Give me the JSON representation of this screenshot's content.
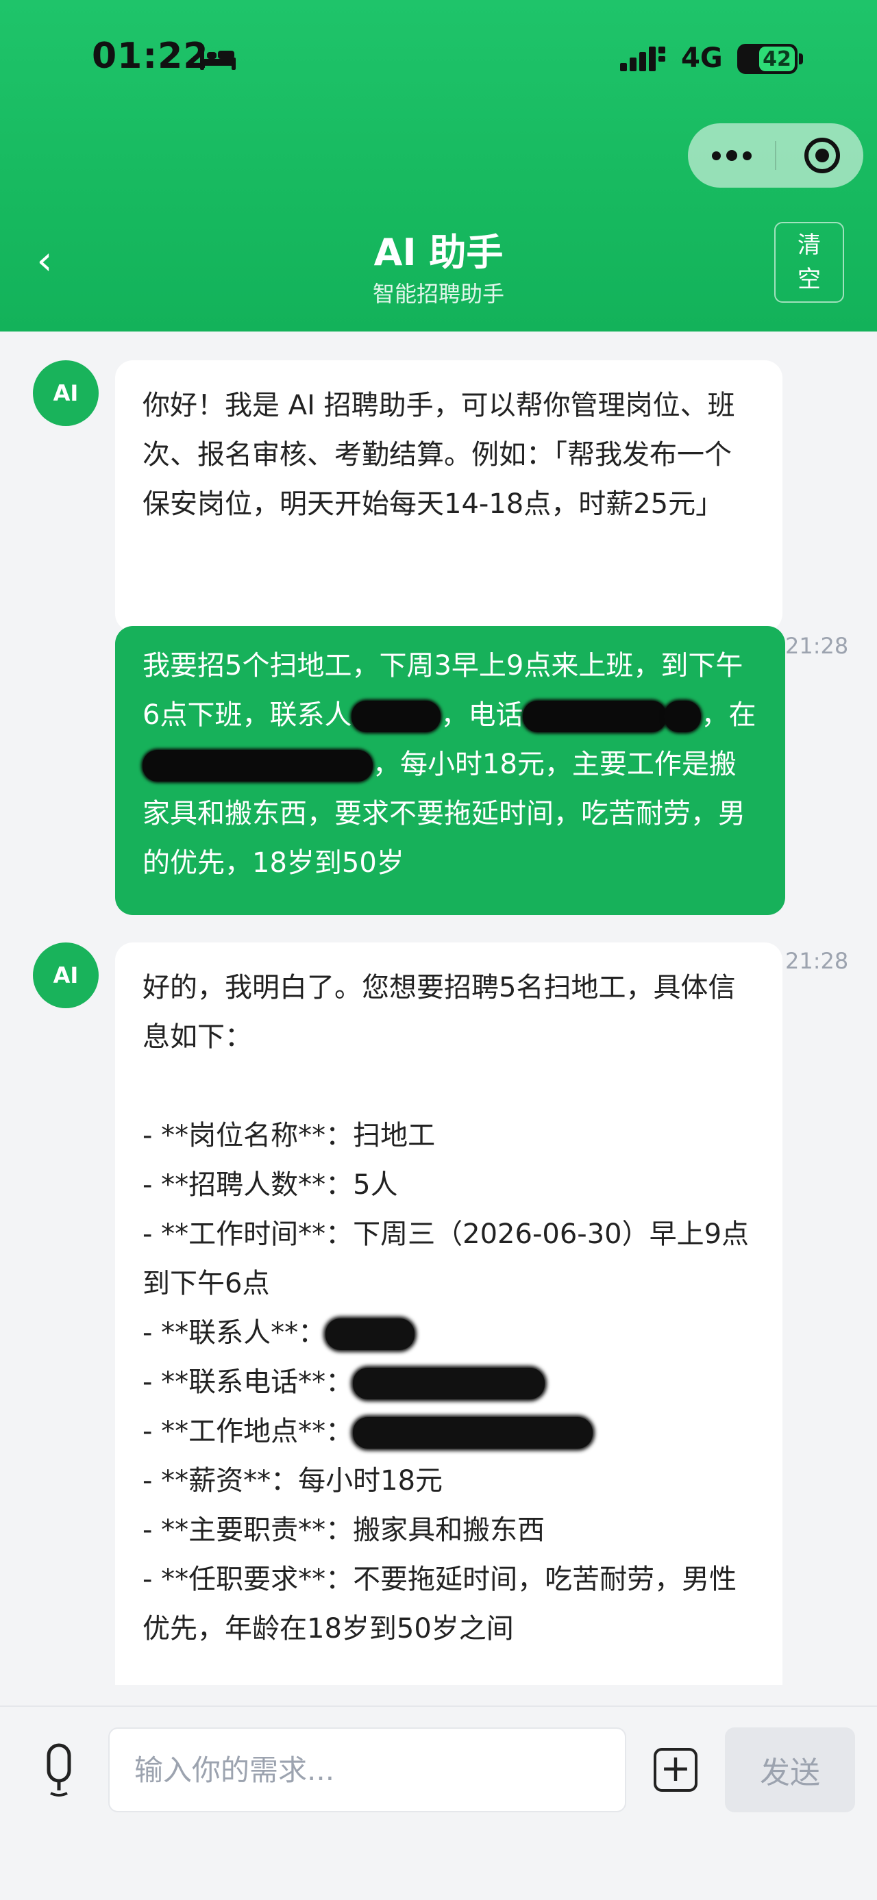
{
  "status_bar": {
    "time": "01:22",
    "network": "4G",
    "battery": "42"
  },
  "nav": {
    "back_icon": "chevron-left-icon",
    "title": "AI 助手",
    "subtitle": "智能招聘助手",
    "clear_label": "清空"
  },
  "theme": {
    "accent": "#17b15a",
    "header": "#1fc46a"
  },
  "messages": [
    {
      "role": "ai",
      "avatar": "AI",
      "text": "你好！我是 AI 招聘助手，可以帮你管理岗位、班次、报名审核、考勤结算。例如：「帮我发布一个保安岗位，明天开始每天14-18点，时薪25元」"
    },
    {
      "role": "user",
      "timestamp": "21:28",
      "parts": [
        "我要招5个扫地工，下周3早上9点来上班，到下午6点下班，联系人",
        "，电话",
        "，在",
        "，每小时18元，主要工作是搬家具和搬东西，要求不要拖延时间，吃苦耐劳，男的优先，18岁到50岁"
      ]
    },
    {
      "role": "ai",
      "avatar": "AI",
      "timestamp": "21:28",
      "intro": "好的，我明白了。您想要招聘5名扫地工，具体信息如下：",
      "items": {
        "position": "- **岗位名称**：扫地工",
        "headcount": "- **招聘人数**：5人",
        "work_time": "- **工作时间**：下周三（2026-06-30）早上9点到下午6点",
        "contact": "- **联系人**：",
        "phone": "- **联系电话**：",
        "location": "- **工作地点**：",
        "salary": "- **薪资**：每小时18元",
        "duties": "- **主要职责**：搬家具和搬东西",
        "requirements": "- **任职要求**：不要拖延时间，吃苦耐劳，男性优先，年龄在18岁到50岁之间"
      }
    }
  ],
  "input": {
    "placeholder": "输入你的需求...",
    "send_label": "发送",
    "mic_icon": "microphone-icon",
    "plus_icon": "plus-icon"
  }
}
